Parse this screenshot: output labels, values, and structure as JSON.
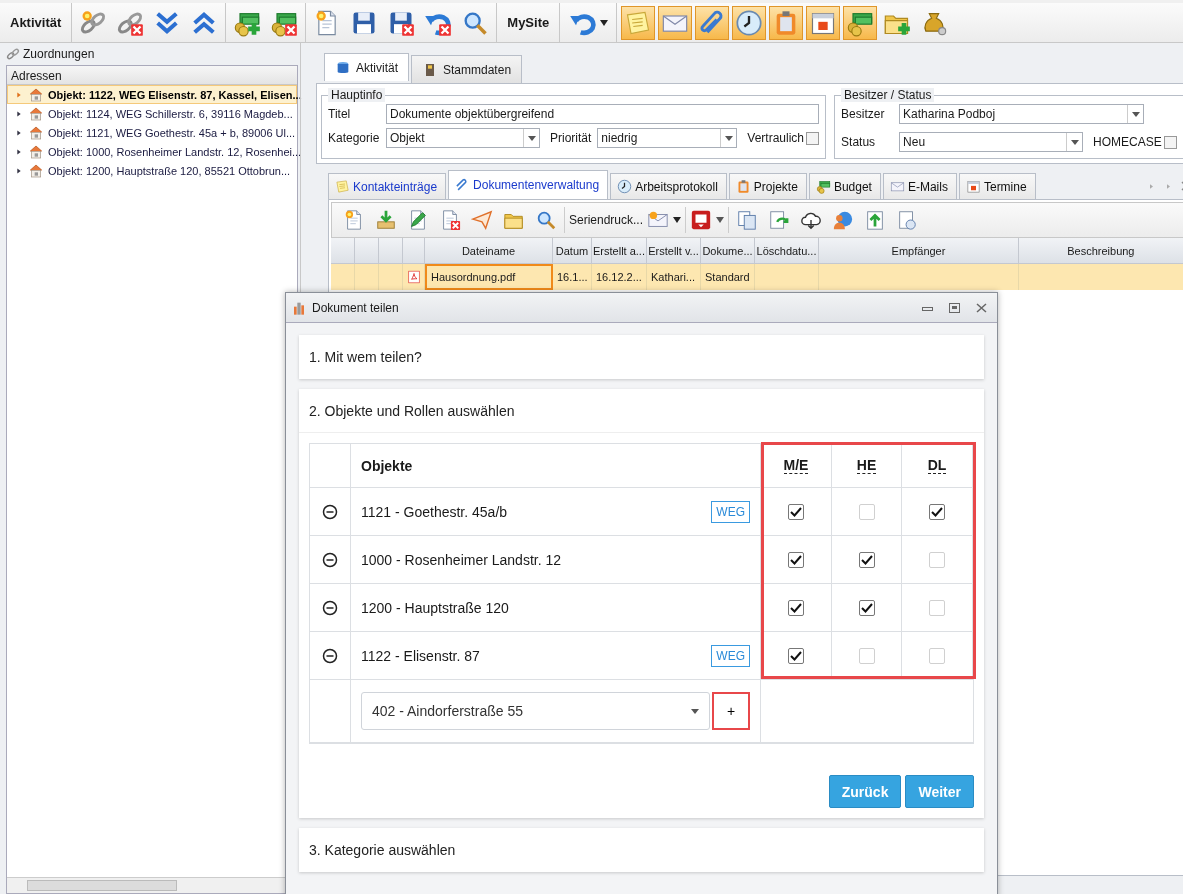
{
  "toolbar": {
    "title": "Aktivität",
    "site_label": "MySite",
    "toggles": [
      {
        "on": true
      },
      {
        "on": true
      },
      {
        "on": true
      },
      {
        "on": true
      },
      {
        "on": true
      },
      {
        "on": true
      },
      {
        "on": true
      }
    ]
  },
  "left_panel": {
    "title": "Zuordnungen",
    "header": "Adressen",
    "items": [
      {
        "label": "Objekt: 1122, WEG Elisenstr. 87, Kassel, Elisen...",
        "selected": true
      },
      {
        "label": "Objekt: 1124, WEG Schillerstr. 6, 39116 Magdeb...",
        "selected": false
      },
      {
        "label": "Objekt: 1121, WEG Goethestr. 45a + b, 89006 Ul...",
        "selected": false
      },
      {
        "label": "Objekt: 1000, Rosenheimer Landstr. 12, Rosenhei...",
        "selected": false
      },
      {
        "label": "Objekt: 1200, Hauptstraße 120, 85521 Ottobrun...",
        "selected": false
      }
    ]
  },
  "main_tabs": [
    {
      "label": "Aktivität",
      "selected": true
    },
    {
      "label": "Stammdaten",
      "selected": false
    }
  ],
  "hauptinfo": {
    "title": "Hauptinfo",
    "titel_label": "Titel",
    "titel_value": "Dokumente objektübergreifend",
    "kategorie_label": "Kategorie",
    "kategorie_value": "Objekt",
    "prioritaet_label": "Priorität",
    "prioritaet_value": "niedrig",
    "vertraulich_label": "Vertraulich",
    "vertraulich_checked": false
  },
  "besitzer_status": {
    "title": "Besitzer / Status",
    "besitzer_label": "Besitzer",
    "besitzer_value": "Katharina Podboj",
    "status_label": "Status",
    "status_value": "Neu",
    "homecase_label": "HOMECASE",
    "homecase_checked": false
  },
  "detail_tabs": [
    {
      "label": "Kontakteinträge",
      "selected": false,
      "highlighted": true
    },
    {
      "label": "Dokumentenverwaltung",
      "selected": true,
      "highlighted": true
    },
    {
      "label": "Arbeitsprotokoll",
      "selected": false,
      "highlighted": false
    },
    {
      "label": "Projekte",
      "selected": false,
      "highlighted": false
    },
    {
      "label": "Budget",
      "selected": false,
      "highlighted": false
    },
    {
      "label": "E-Mails",
      "selected": false,
      "highlighted": false
    },
    {
      "label": "Termine",
      "selected": false,
      "highlighted": false
    }
  ],
  "documents": {
    "toolbar_label": "Seriendruck...",
    "columns": [
      "Dateiname",
      "Datum",
      "Erstellt a...",
      "Erstellt v...",
      "Dokume...",
      "Löschdatu...",
      "Empfänger",
      "Beschreibung"
    ],
    "rows": [
      {
        "cells": [
          "Hausordnung.pdf",
          "16.1...",
          "16.12.2...",
          "Kathari...",
          "Standard"
        ],
        "selected": true
      }
    ]
  },
  "dialog": {
    "title": "Dokument teilen",
    "steps": [
      {
        "title": "1. Mit wem teilen?",
        "expanded": false
      },
      {
        "title": "2. Objekte und Rollen auswählen",
        "expanded": true
      },
      {
        "title": "3. Kategorie auswählen",
        "expanded": false
      }
    ],
    "objects_table": {
      "object_header": "Objekte",
      "roles": [
        "M/E",
        "HE",
        "DL"
      ],
      "rows": [
        {
          "name": "1121 - Goethestr. 45a/b",
          "tag": "WEG",
          "roles": [
            true,
            false,
            true
          ]
        },
        {
          "name": "1000 - Rosenheimer Landstr. 12",
          "roles": [
            true,
            true,
            false
          ]
        },
        {
          "name": "1200 - Hauptstraße 120",
          "roles": [
            true,
            true,
            false
          ]
        },
        {
          "name": "1122 - Elisenstr. 87",
          "tag": "WEG",
          "roles": [
            true,
            false,
            false
          ]
        }
      ],
      "add_value": "402 - Aindorferstraße 55",
      "add_button": "+"
    },
    "buttons": [
      "Zurück",
      "Weiter"
    ]
  }
}
